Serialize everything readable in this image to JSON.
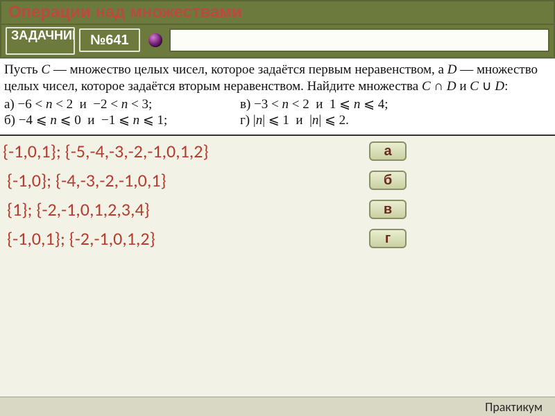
{
  "header": {
    "title": "Операции над множествами"
  },
  "toolbar": {
    "badge": "ЗАДАЧНИК",
    "number": "№641",
    "search_value": ""
  },
  "problem": {
    "intro_html": "Пусть <span class='ital'>C</span> — множество целых чисел, которое задаётся первым неравенством, а <span class='ital'>D</span> — множество целых чисел, которое задаётся вторым неравенством. Найдите множества <span class='ital'>C</span> ∩ <span class='ital'>D</span> и <span class='ital'>C</span> ∪ <span class='ital'>D</span>:",
    "subparts": [
      {
        "key": "a",
        "label": "а)",
        "text_html": "−6 &lt; <span class='ital'>n</span> &lt; 2&nbsp;&nbsp;и&nbsp;&nbsp;−2 &lt; <span class='ital'>n</span> &lt; 3;"
      },
      {
        "key": "b",
        "label": "б)",
        "text_html": "−4 ⩽ <span class='ital'>n</span> ⩽ 0&nbsp;&nbsp;и&nbsp;&nbsp;−1 ⩽ <span class='ital'>n</span> ⩽ 1;"
      },
      {
        "key": "v",
        "label": "в)",
        "text_html": "−3 &lt; <span class='ital'>n</span> &lt; 2&nbsp;&nbsp;и&nbsp;&nbsp;1 ⩽ <span class='ital'>n</span> ⩽ 4;"
      },
      {
        "key": "g",
        "label": "г)",
        "text_html": "|<span class='ital'>n</span>| ⩽ 1&nbsp;&nbsp;и&nbsp;&nbsp;|<span class='ital'>n</span>| ⩽ 2."
      }
    ]
  },
  "answers": [
    {
      "text": "{-1,0,1};  {-5,-4,-3,-2,-1,0,1,2}",
      "button": "а"
    },
    {
      "text": "{-1,0};  {-4,-3,-2,-1,0,1}",
      "button": "б"
    },
    {
      "text": "{1};  {-2,-1,0,1,2,3,4}",
      "button": "в"
    },
    {
      "text": "{-1,0,1};  {-2,-1,0,1,2}",
      "button": "г"
    }
  ],
  "footer": {
    "label": "Практикум"
  }
}
